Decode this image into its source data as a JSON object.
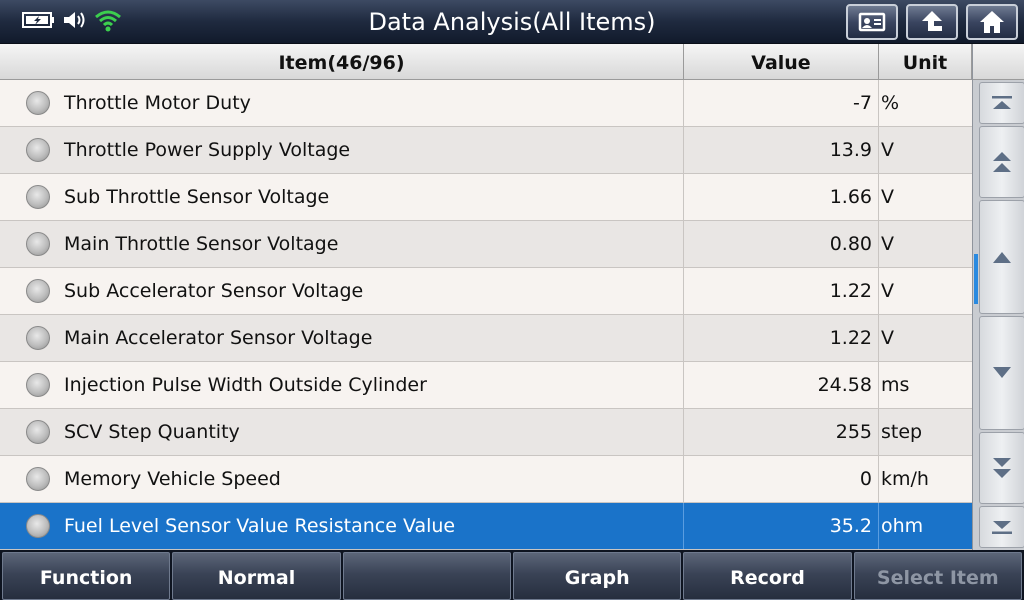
{
  "header": {
    "title": "Data Analysis(All Items)"
  },
  "table": {
    "columns": {
      "item": "Item(46/96)",
      "value": "Value",
      "unit": "Unit"
    },
    "rows": [
      {
        "name": "Throttle Motor Duty",
        "value": "-7",
        "unit": "%"
      },
      {
        "name": "Throttle Power Supply Voltage",
        "value": "13.9",
        "unit": "V"
      },
      {
        "name": "Sub Throttle Sensor Voltage",
        "value": "1.66",
        "unit": "V"
      },
      {
        "name": "Main Throttle Sensor Voltage",
        "value": "0.80",
        "unit": "V"
      },
      {
        "name": "Sub Accelerator Sensor Voltage",
        "value": "1.22",
        "unit": "V"
      },
      {
        "name": "Main Accelerator Sensor Voltage",
        "value": "1.22",
        "unit": "V"
      },
      {
        "name": "Injection Pulse Width Outside Cylinder",
        "value": "24.58",
        "unit": "ms"
      },
      {
        "name": "SCV Step Quantity",
        "value": "255",
        "unit": "step"
      },
      {
        "name": "Memory Vehicle Speed",
        "value": "0",
        "unit": "km/h"
      },
      {
        "name": "Fuel Level Sensor Value Resistance Value",
        "value": "35.2",
        "unit": "ohm"
      }
    ],
    "selected_index": 9
  },
  "toolbar": {
    "function": "Function",
    "normal": "Normal",
    "empty": "",
    "graph": "Graph",
    "record": "Record",
    "select_item": "Select Item"
  },
  "colors": {
    "selected_row": "#1a73c9",
    "wifi": "#3ccf4e"
  },
  "icons": [
    "battery-icon",
    "speaker-icon",
    "wifi-icon",
    "report-icon",
    "back-icon",
    "home-icon",
    "first-page-icon",
    "page-up-icon",
    "line-up-icon",
    "line-down-icon",
    "page-down-icon",
    "last-page-icon"
  ]
}
